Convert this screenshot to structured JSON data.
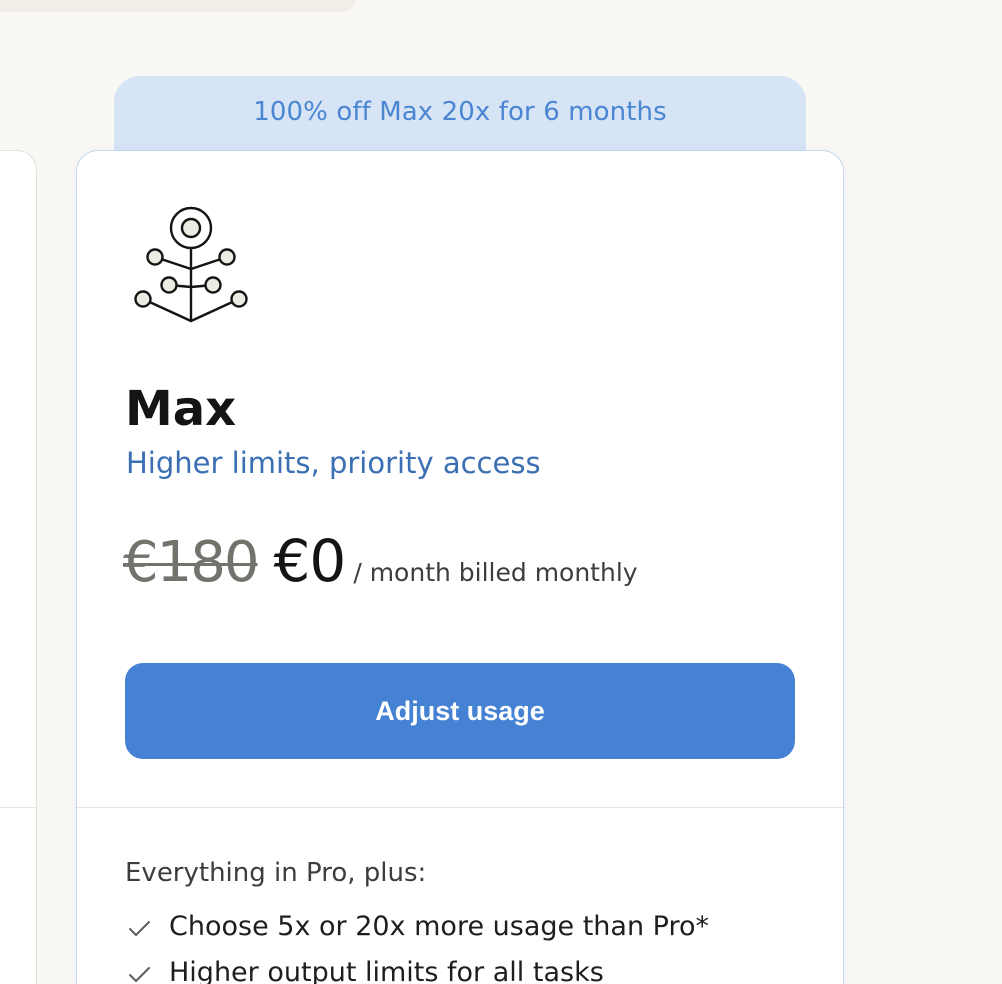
{
  "promo": {
    "text": "100% off Max 20x for 6 months"
  },
  "plan": {
    "icon": "branching-tree-icon",
    "name": "Max",
    "tagline": "Higher limits, priority access",
    "price_original": "€180",
    "price_current": "€0",
    "price_period": "/ month billed monthly",
    "cta_label": "Adjust usage",
    "features_heading": "Everything in Pro, plus:",
    "features": [
      "Choose 5x or 20x more usage than Pro*",
      "Higher output limits for all tasks"
    ]
  },
  "colors": {
    "accent": "#4682d4",
    "tagline": "#3b6fb4",
    "banner_bg": "#d6e4f6",
    "banner_text": "#4a86d2"
  }
}
